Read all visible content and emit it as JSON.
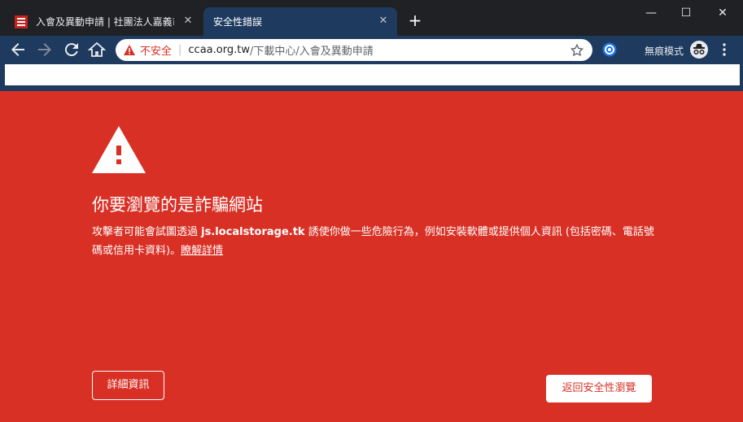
{
  "tabs": [
    {
      "title": "入會及異動申請 | 社團法人嘉義市",
      "active": false
    },
    {
      "title": "安全性錯誤",
      "active": true
    }
  ],
  "omnibox": {
    "security_label": "不安全",
    "separator": "|",
    "host": "ccaa.org.tw",
    "path": "/下載中心/入會及異動申請"
  },
  "incognito_label": "無痕模式",
  "warning": {
    "heading": "你要瀏覽的是詐騙網站",
    "text_before": "攻擊者可能會試圖透過 ",
    "domain": "js.localstorage.tk",
    "text_after": " 誘使你做一些危險行為，例如安裝軟體或提供個人資訊 (包括密碼、電話號碼或信用卡資料)。",
    "learn_more": "瞭解詳情"
  },
  "buttons": {
    "details": "詳細資訊",
    "back_to_safety": "返回安全性瀏覽"
  },
  "colors": {
    "danger_red": "#d93025",
    "toolbar_navy": "#1e3a5f",
    "titlebar": "#202124"
  }
}
